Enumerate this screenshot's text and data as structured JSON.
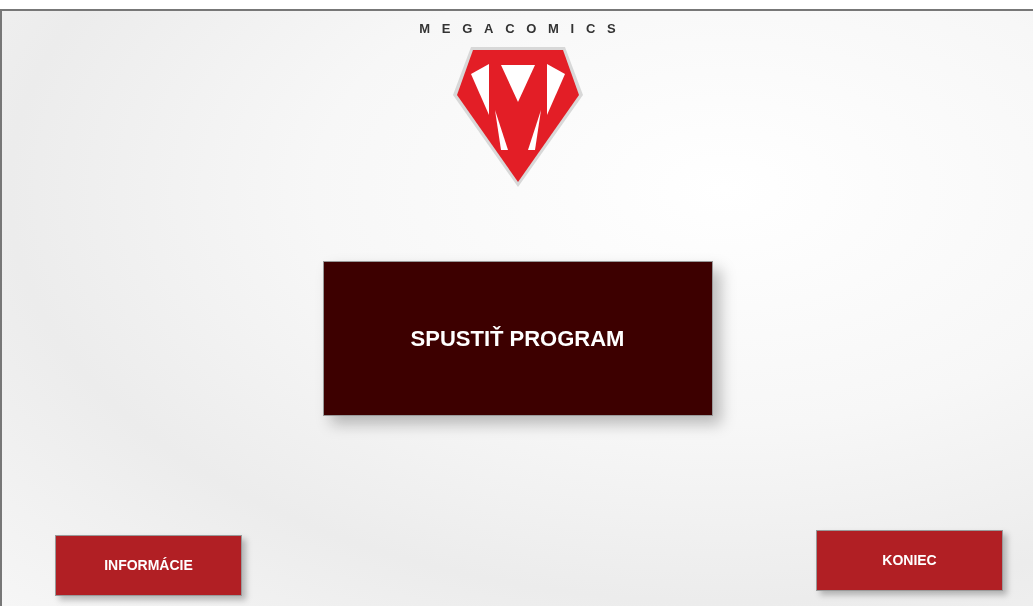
{
  "logo": {
    "text": "MEGACOMICS"
  },
  "buttons": [
    {
      "label": "SPUSTIŤ PROGRAM",
      "kind": "primary"
    },
    {
      "label": "INFORMÁCIE",
      "kind": "left"
    },
    {
      "label": "KONIEC",
      "kind": "right"
    }
  ]
}
